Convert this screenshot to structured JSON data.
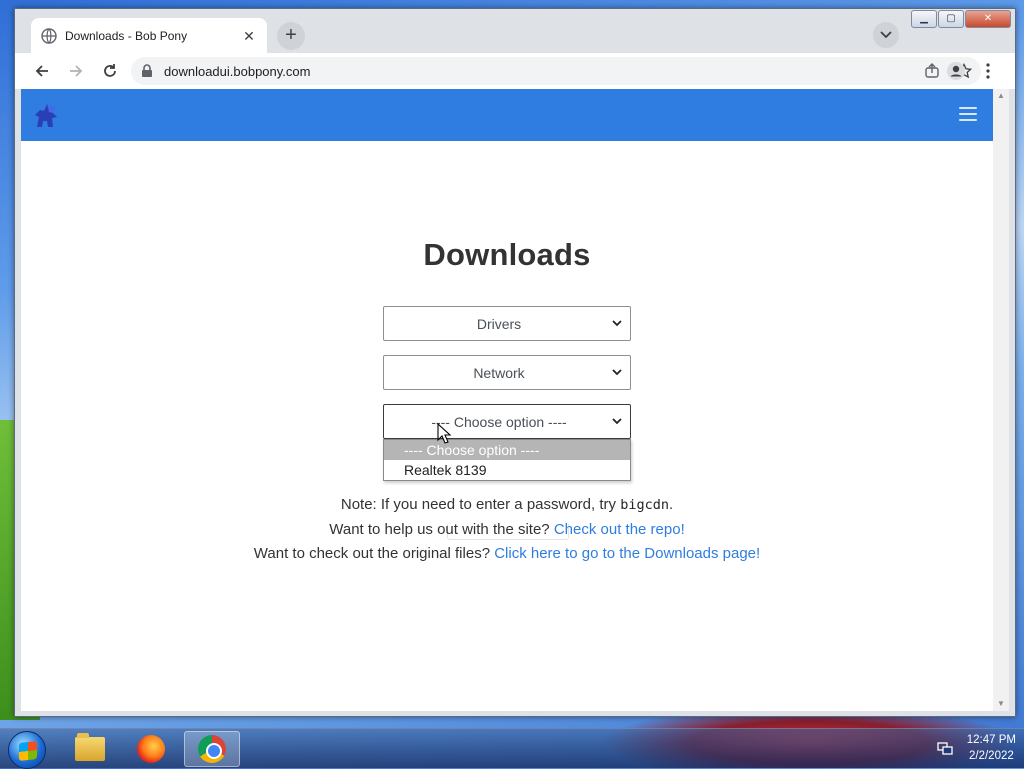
{
  "browser": {
    "tab_title": "Downloads - Bob Pony",
    "url": "downloadui.bobpony.com"
  },
  "page": {
    "heading": "Downloads",
    "select_category": "Drivers",
    "select_type": "Network",
    "select_item": "---- Choose option ----",
    "dropdown_options": [
      "---- Choose option ----",
      "Realtek 8139"
    ],
    "note_prefix": "Note: If you need to enter a password, try ",
    "note_password": "bigcdn",
    "note_suffix": ".",
    "help_prefix": "Want to help us out with the site? ",
    "help_link": "Check out the repo!",
    "original_prefix": "Want to check out the original files? ",
    "original_link": "Click here to go to the Downloads page!"
  },
  "taskbar": {
    "clock_time": "12:47 PM",
    "clock_date": "2/2/2022"
  },
  "colors": {
    "navbar": "#2f7de1",
    "link": "#2f7de1"
  }
}
